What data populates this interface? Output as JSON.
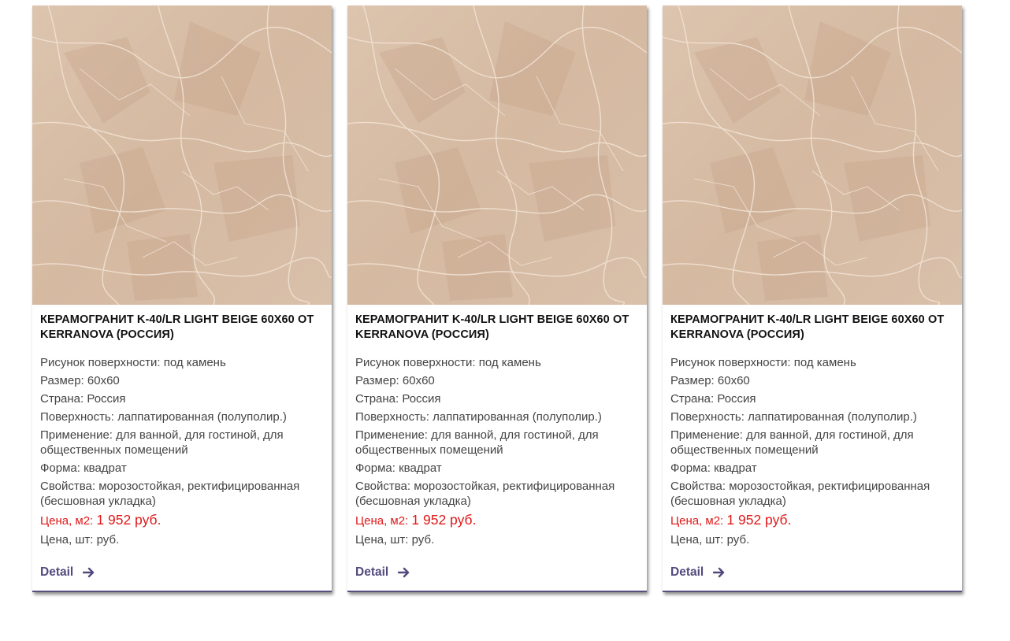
{
  "products": [
    {
      "title": "КЕРАМОГРАНИТ K-40/LR LIGHT BEIGE 60X60 ОТ KERRANOVA (РОССИЯ)",
      "specs": [
        "Рисунок поверхности: под камень",
        "Размер: 60x60",
        "Страна: Россия",
        "Поверхность: лаппатированная (полуполир.)",
        "Применение: для ванной, для гостиной, для общественных помещений",
        "Форма: квадрат",
        "Свойства: морозостойкая, ректифицированная (бесшовная укладка)"
      ],
      "price_label": "Цена, м2:",
      "price_value": "1 952 руб.",
      "pcs_price": "Цена, шт:  руб.",
      "detail_label": "Detail",
      "detail_icon": "arrow-right-icon"
    },
    {
      "title": "КЕРАМОГРАНИТ K-40/LR LIGHT BEIGE 60X60 ОТ KERRANOVA (РОССИЯ)",
      "specs": [
        "Рисунок поверхности: под камень",
        "Размер: 60x60",
        "Страна: Россия",
        "Поверхность: лаппатированная (полуполир.)",
        "Применение: для ванной, для гостиной, для общественных помещений",
        "Форма: квадрат",
        "Свойства: морозостойкая, ректифицированная (бесшовная укладка)"
      ],
      "price_label": "Цена, м2:",
      "price_value": "1 952 руб.",
      "pcs_price": "Цена, шт:  руб.",
      "detail_label": "Detail",
      "detail_icon": "arrow-right-icon"
    },
    {
      "title": "КЕРАМОГРАНИТ K-40/LR LIGHT BEIGE 60X60 ОТ KERRANOVA (РОССИЯ)",
      "specs": [
        "Рисунок поверхности: под камень",
        "Размер: 60x60",
        "Страна: Россия",
        "Поверхность: лаппатированная (полуполир.)",
        "Применение: для ванной, для гостиной, для общественных помещений",
        "Форма: квадрат",
        "Свойства: морозостойкая, ректифицированная (бесшовная укладка)"
      ],
      "price_label": "Цена, м2:",
      "price_value": "1 952 руб.",
      "pcs_price": "Цена, шт:  руб.",
      "detail_label": "Detail",
      "detail_icon": "arrow-right-icon"
    }
  ],
  "colors": {
    "accent": "#524a7e",
    "price": "#e01818",
    "tile_base": "#d9bfa8"
  }
}
